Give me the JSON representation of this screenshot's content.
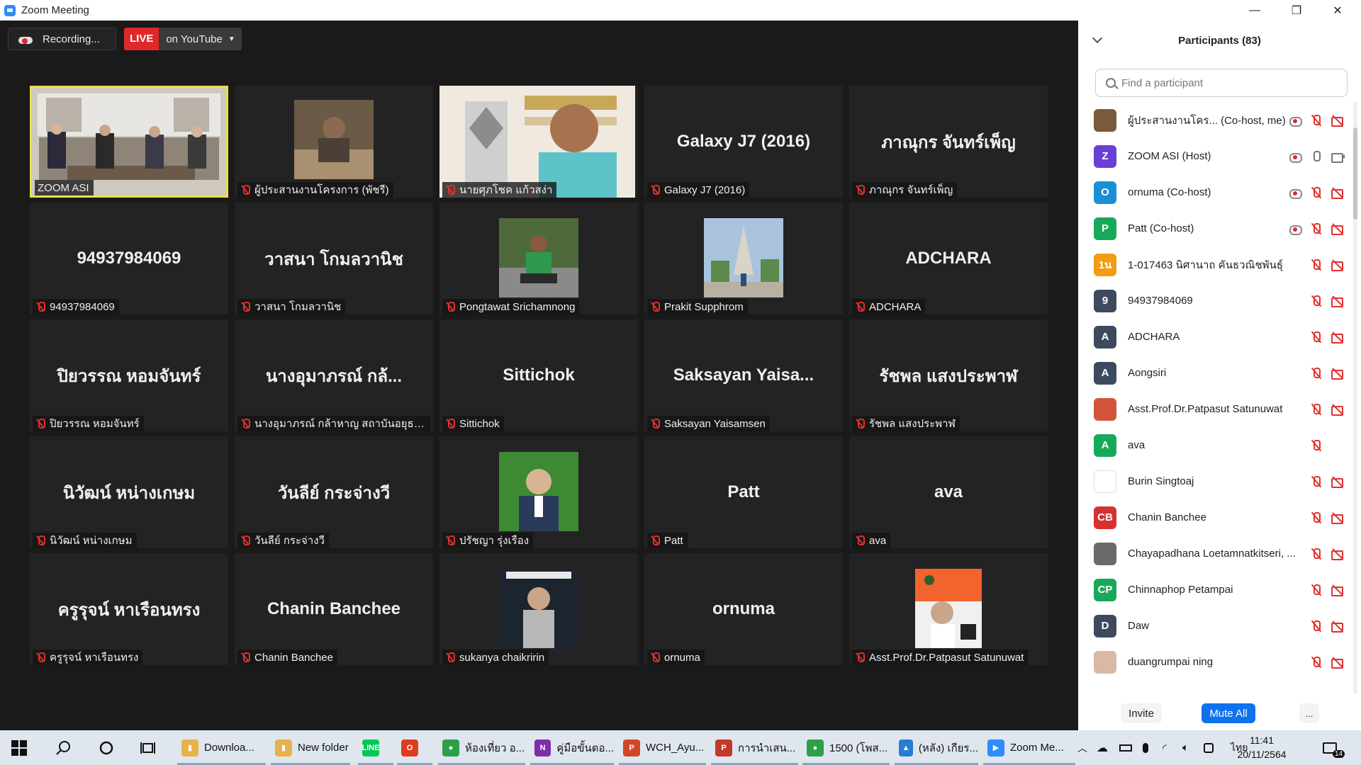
{
  "window": {
    "title": "Zoom Meeting",
    "min_glyph": "—",
    "max_glyph": "❐",
    "close_glyph": "✕"
  },
  "recording": {
    "label": "Recording..."
  },
  "live": {
    "badge": "LIVE",
    "target": "on YouTube",
    "caret": "▼"
  },
  "tiles": [
    {
      "name": "ZOOM ASI",
      "big": "",
      "active": true,
      "photo": "room",
      "muted": false
    },
    {
      "name": "ผู้ประสานงานโครงการ (พัชรี)",
      "big": "",
      "photo": "man-desk",
      "muted": true
    },
    {
      "name": "นายศุภโชค แก้วสง่า",
      "big": "",
      "photo": "presenter",
      "muted": true
    },
    {
      "name": "Galaxy J7 (2016)",
      "big": "Galaxy J7 (2016)",
      "muted": true
    },
    {
      "name": "ภาณุกร จันทร์เพ็ญ",
      "big": "ภาณุกร จันทร์เพ็ญ",
      "muted": true
    },
    {
      "name": "94937984069",
      "big": "94937984069",
      "muted": true
    },
    {
      "name": "วาสนา โกมลวานิช",
      "big": "วาสนา โกมลวานิช",
      "muted": true
    },
    {
      "name": "Pongtawat Srichamnong",
      "big": "",
      "photo": "man-sitting",
      "muted": true
    },
    {
      "name": "Prakit Supphrom",
      "big": "",
      "photo": "temple",
      "muted": true
    },
    {
      "name": "ADCHARA",
      "big": "ADCHARA",
      "muted": true
    },
    {
      "name": "ปิยวรรณ หอมจันทร์",
      "big": "ปิยวรรณ หอมจันทร์",
      "muted": true
    },
    {
      "name": "นางอุมาภรณ์  กล้าหาญ สถาบันอยุธยาศึ...",
      "big": "นางอุมาภรณ์  กล้...",
      "muted": true
    },
    {
      "name": "Sittichok",
      "big": "Sittichok",
      "muted": true
    },
    {
      "name": "Saksayan Yaisamsen",
      "big": "Saksayan  Yaisa...",
      "muted": true
    },
    {
      "name": "รัชพล  แสงประพาฬ",
      "big": "รัชพล  แสงประพาฬ",
      "muted": true
    },
    {
      "name": "นิวัฒน์ หน่างเกษม",
      "big": "นิวัฒน์ หน่างเกษม",
      "muted": true
    },
    {
      "name": "วันลีย์ กระจ่างวี",
      "big": "วันลีย์ กระจ่างวี",
      "muted": true
    },
    {
      "name": "ปรัชญา รุ่งเรือง",
      "big": "",
      "photo": "man-green",
      "muted": true
    },
    {
      "name": "Patt",
      "big": "Patt",
      "muted": true
    },
    {
      "name": "ava",
      "big": "ava",
      "muted": true
    },
    {
      "name": "ครูรุจน์ หาเรือนทรง",
      "big": "ครูรุจน์ หาเรือนทรง",
      "muted": true
    },
    {
      "name": "Chanin Banchee",
      "big": "Chanin Banchee",
      "muted": true
    },
    {
      "name": "sukanya chaikririn",
      "big": "",
      "photo": "woman",
      "muted": true
    },
    {
      "name": "ornuma",
      "big": "ornuma",
      "muted": true
    },
    {
      "name": "Asst.Prof.Dr.Patpasut Satunuwat",
      "big": "",
      "photo": "poster",
      "muted": true
    }
  ],
  "panel": {
    "title": "Participants (83)",
    "search_placeholder": "Find a participant",
    "invite": "Invite",
    "mute_all": "Mute All",
    "more": "..."
  },
  "participants": [
    {
      "name": "ผู้ประสานงานโคร...  (Co-host, me)",
      "initials": "",
      "color": "#7a5a3a",
      "rec": true,
      "mic": "off",
      "cam": "off"
    },
    {
      "name": "ZOOM ASI (Host)",
      "initials": "Z",
      "color": "#6a3fd3",
      "rec": true,
      "mic": "on",
      "cam": "on"
    },
    {
      "name": "ornuma (Co-host)",
      "initials": "O",
      "color": "#1a8fd6",
      "rec": true,
      "mic": "off",
      "cam": "off"
    },
    {
      "name": "Patt (Co-host)",
      "initials": "P",
      "color": "#18a85a",
      "rec": true,
      "mic": "off",
      "cam": "off"
    },
    {
      "name": "1-017463 นิศานาถ คันธวณิชพันธุ์",
      "initials": "1น",
      "color": "#f29c11",
      "rec": false,
      "mic": "off",
      "cam": "off"
    },
    {
      "name": "94937984069",
      "initials": "9",
      "color": "#3d4a5e",
      "rec": false,
      "mic": "off",
      "cam": "off"
    },
    {
      "name": "ADCHARA",
      "initials": "A",
      "color": "#3d4a5e",
      "rec": false,
      "mic": "off",
      "cam": "off"
    },
    {
      "name": "Aongsiri",
      "initials": "A",
      "color": "#3d4a5e",
      "rec": false,
      "mic": "off",
      "cam": "off"
    },
    {
      "name": "Asst.Prof.Dr.Patpasut Satunuwat",
      "initials": "",
      "color": "#d0553a",
      "rec": false,
      "mic": "off",
      "cam": "off"
    },
    {
      "name": "ava",
      "initials": "A",
      "color": "#18a85a",
      "rec": false,
      "mic": "off",
      "cam": "none"
    },
    {
      "name": "Burin Singtoaj",
      "initials": "",
      "color": "#ffffff",
      "rec": false,
      "mic": "off",
      "cam": "off"
    },
    {
      "name": "Chanin Banchee",
      "initials": "CB",
      "color": "#d63030",
      "rec": false,
      "mic": "off",
      "cam": "off"
    },
    {
      "name": "Chayapadhana Loetamnatkitseri, ...",
      "initials": "",
      "color": "#6a6a6a",
      "rec": false,
      "mic": "off",
      "cam": "off"
    },
    {
      "name": "Chinnaphop Petampai",
      "initials": "CP",
      "color": "#18a85a",
      "rec": false,
      "mic": "off",
      "cam": "off"
    },
    {
      "name": "Daw",
      "initials": "D",
      "color": "#3d4a5e",
      "rec": false,
      "mic": "off",
      "cam": "off"
    },
    {
      "name": "duangrumpai ning",
      "initials": "",
      "color": "#d9b9a3",
      "rec": false,
      "mic": "off",
      "cam": "off"
    }
  ],
  "taskbar": {
    "items": [
      {
        "label": "Downloa...",
        "glyph": "▮",
        "color": "#e6b24a"
      },
      {
        "label": "New folder",
        "glyph": "▮",
        "color": "#e6b24a"
      },
      {
        "label": "",
        "glyph": "LINE",
        "color": "#06c755"
      },
      {
        "label": "",
        "glyph": "O",
        "color": "#e03c1f"
      },
      {
        "label": "ห้องเที่ยว อ...",
        "glyph": "●",
        "color": "#2d9f48"
      },
      {
        "label": "คู่มือขั้นตอ...",
        "glyph": "N",
        "color": "#7b2fa8"
      },
      {
        "label": "WCH_Ayu...",
        "glyph": "P",
        "color": "#d24726"
      },
      {
        "label": "การนำเสน...",
        "glyph": "P",
        "color": "#c0392b"
      },
      {
        "label": "1500 (โพส...",
        "glyph": "●",
        "color": "#2d9f48"
      },
      {
        "label": "(หลัง) เกียร...",
        "glyph": "▲",
        "color": "#2b7cd3"
      },
      {
        "label": "Zoom Me...",
        "glyph": "▶",
        "color": "#2d8cff"
      }
    ],
    "lang": "ไทย",
    "time": "11:41",
    "date": "20/11/2564",
    "notif_count": "14"
  }
}
